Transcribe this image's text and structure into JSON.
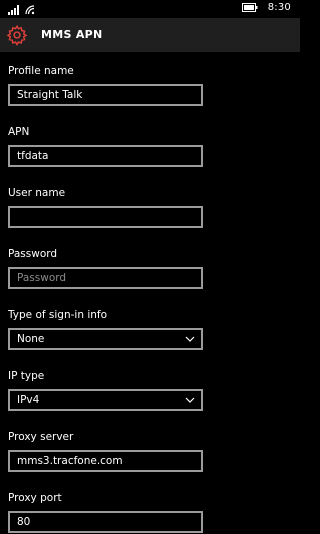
{
  "status": {
    "time": "8:30"
  },
  "header": {
    "title": "MMS APN",
    "icon": "gear-icon"
  },
  "fields": [
    {
      "label": "Profile name",
      "value": "Straight Talk",
      "placeholder": ""
    },
    {
      "label": "APN",
      "value": "tfdata",
      "placeholder": ""
    },
    {
      "label": "User name",
      "value": "",
      "placeholder": ""
    },
    {
      "label": "Password",
      "value": "",
      "placeholder": "Password"
    },
    {
      "label": "Type of sign-in info",
      "value": "None",
      "type": "select"
    },
    {
      "label": "IP type",
      "value": "IPv4",
      "type": "select"
    },
    {
      "label": "Proxy server",
      "value": "mms3.tracfone.com",
      "placeholder": ""
    },
    {
      "label": "Proxy port",
      "value": "80",
      "placeholder": ""
    }
  ],
  "colors": {
    "accent": "#e0403a",
    "header_bg": "#1f1f1f",
    "field_border": "#9b9b9b"
  }
}
